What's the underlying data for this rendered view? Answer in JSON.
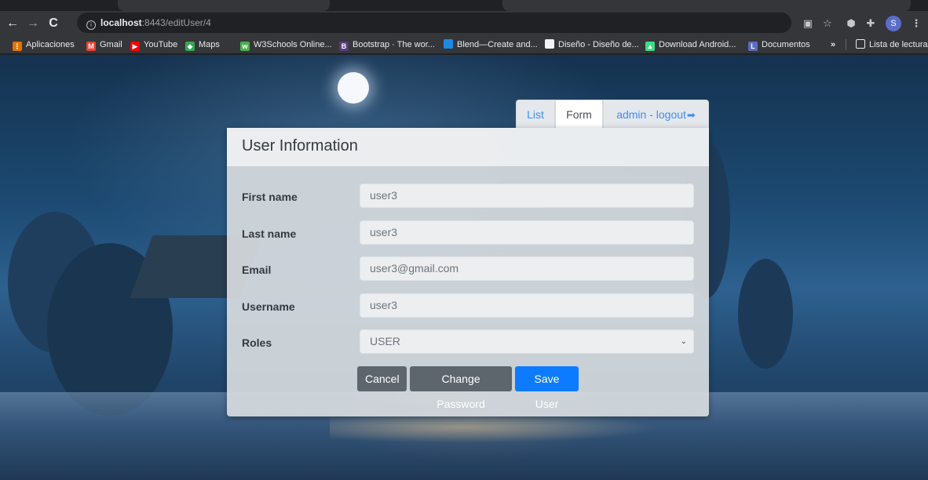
{
  "browser": {
    "url_host": "localhost",
    "url_path": ":8443/editUser/4",
    "profile_initial": "S",
    "icons": {
      "back": "back-arrow-icon",
      "forward": "forward-arrow-icon",
      "reload": "reload-icon",
      "translate": "translate-icon",
      "bookmark_star": "star-icon",
      "extension": "extension-icon",
      "puzzle": "puzzle-icon",
      "menu": "kebab-menu-icon"
    }
  },
  "bookmarks": {
    "items": [
      {
        "label": "Aplicaciones",
        "icon": "apps-grid-icon",
        "color": "#e37400"
      },
      {
        "label": "Gmail",
        "icon": "gmail-icon",
        "color": "#ea4335"
      },
      {
        "label": "YouTube",
        "icon": "youtube-icon",
        "color": "#ff0000"
      },
      {
        "label": "Maps",
        "icon": "maps-icon",
        "color": "#34a853"
      },
      {
        "label": "W3Schools Online...",
        "icon": "w3schools-icon",
        "color": "#4caf50"
      },
      {
        "label": "Bootstrap · The wor...",
        "icon": "bootstrap-icon",
        "color": "#563d7c"
      },
      {
        "label": "Blend—Create and...",
        "icon": "blend-icon",
        "color": "#1e88e5"
      },
      {
        "label": "Diseño - Diseño de...",
        "icon": "page-icon",
        "color": "#f1f3f4"
      },
      {
        "label": "Download Android...",
        "icon": "android-icon",
        "color": "#3ddc84"
      },
      {
        "label": "Documentos",
        "icon": "docs-icon",
        "color": "#5c6bc0"
      }
    ],
    "overflow": "»",
    "reading_list": "Lista de lectura"
  },
  "tabs": {
    "list": "List",
    "form": "Form",
    "logout": "admin - logout"
  },
  "card": {
    "title": "User Information",
    "fields": [
      {
        "label": "First name",
        "value": "user3"
      },
      {
        "label": "Last name",
        "value": "user3"
      },
      {
        "label": "Email",
        "value": "user3@gmail.com"
      },
      {
        "label": "Username",
        "value": "user3"
      },
      {
        "label": "Roles",
        "value": "USER"
      }
    ]
  },
  "buttons": {
    "cancel": "Cancel",
    "change_password": "Change Password",
    "save": "Save User"
  },
  "colors": {
    "primary": "#0d7bff",
    "secondary": "#5e666d",
    "link": "#3d8ef8"
  }
}
